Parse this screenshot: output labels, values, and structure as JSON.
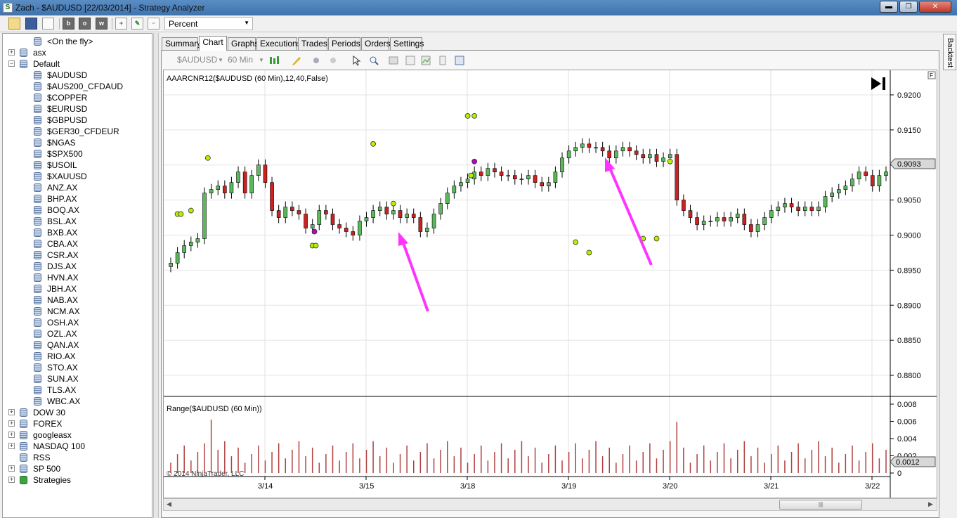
{
  "window": {
    "title": "Zach - $AUDUSD [22/03/2014] - Strategy Analyzer",
    "app_icon": "ninjatrader-icon",
    "controls": [
      "minimize-icon",
      "maximize-icon",
      "close-icon"
    ],
    "control_glyphs": [
      "▬",
      "❐",
      "✕"
    ]
  },
  "toolbar": {
    "buttons": [
      "open-folder-icon",
      "save-icon",
      "print-icon",
      "b-icon",
      "o-icon",
      "w-icon",
      "add-icon",
      "edit-icon",
      "remove-icon"
    ],
    "button_glyphs": [
      "",
      "",
      "",
      "b",
      "o",
      "w",
      "+",
      "✎",
      "−"
    ],
    "mode_select": "Percent"
  },
  "tree": {
    "items": [
      {
        "label": "<On the fly>",
        "level": 1,
        "expander": "",
        "icon": "database-icon"
      },
      {
        "label": "asx",
        "level": 0,
        "expander": "+",
        "icon": "database-icon"
      },
      {
        "label": "Default",
        "level": 0,
        "expander": "−",
        "icon": "database-icon"
      },
      {
        "label": "$AUDUSD",
        "level": 1,
        "expander": "",
        "icon": "database-icon"
      },
      {
        "label": "$AUS200_CFDAUD",
        "level": 1,
        "expander": "",
        "icon": "database-icon"
      },
      {
        "label": "$COPPER",
        "level": 1,
        "expander": "",
        "icon": "database-icon"
      },
      {
        "label": "$EURUSD",
        "level": 1,
        "expander": "",
        "icon": "database-icon"
      },
      {
        "label": "$GBPUSD",
        "level": 1,
        "expander": "",
        "icon": "database-icon"
      },
      {
        "label": "$GER30_CFDEUR",
        "level": 1,
        "expander": "",
        "icon": "database-icon"
      },
      {
        "label": "$NGAS",
        "level": 1,
        "expander": "",
        "icon": "database-icon"
      },
      {
        "label": "$SPX500",
        "level": 1,
        "expander": "",
        "icon": "database-icon"
      },
      {
        "label": "$USOIL",
        "level": 1,
        "expander": "",
        "icon": "database-icon"
      },
      {
        "label": "$XAUUSD",
        "level": 1,
        "expander": "",
        "icon": "database-icon"
      },
      {
        "label": "ANZ.AX",
        "level": 1,
        "expander": "",
        "icon": "database-icon"
      },
      {
        "label": "BHP.AX",
        "level": 1,
        "expander": "",
        "icon": "database-icon"
      },
      {
        "label": "BOQ.AX",
        "level": 1,
        "expander": "",
        "icon": "database-icon"
      },
      {
        "label": "BSL.AX",
        "level": 1,
        "expander": "",
        "icon": "database-icon"
      },
      {
        "label": "BXB.AX",
        "level": 1,
        "expander": "",
        "icon": "database-icon"
      },
      {
        "label": "CBA.AX",
        "level": 1,
        "expander": "",
        "icon": "database-icon"
      },
      {
        "label": "CSR.AX",
        "level": 1,
        "expander": "",
        "icon": "database-icon"
      },
      {
        "label": "DJS.AX",
        "level": 1,
        "expander": "",
        "icon": "database-icon"
      },
      {
        "label": "HVN.AX",
        "level": 1,
        "expander": "",
        "icon": "database-icon"
      },
      {
        "label": "JBH.AX",
        "level": 1,
        "expander": "",
        "icon": "database-icon"
      },
      {
        "label": "NAB.AX",
        "level": 1,
        "expander": "",
        "icon": "database-icon"
      },
      {
        "label": "NCM.AX",
        "level": 1,
        "expander": "",
        "icon": "database-icon"
      },
      {
        "label": "OSH.AX",
        "level": 1,
        "expander": "",
        "icon": "database-icon"
      },
      {
        "label": "OZL.AX",
        "level": 1,
        "expander": "",
        "icon": "database-icon"
      },
      {
        "label": "QAN.AX",
        "level": 1,
        "expander": "",
        "icon": "database-icon"
      },
      {
        "label": "RIO.AX",
        "level": 1,
        "expander": "",
        "icon": "database-icon"
      },
      {
        "label": "STO.AX",
        "level": 1,
        "expander": "",
        "icon": "database-icon"
      },
      {
        "label": "SUN.AX",
        "level": 1,
        "expander": "",
        "icon": "database-icon"
      },
      {
        "label": "TLS.AX",
        "level": 1,
        "expander": "",
        "icon": "database-icon"
      },
      {
        "label": "WBC.AX",
        "level": 1,
        "expander": "",
        "icon": "database-icon"
      },
      {
        "label": "DOW 30",
        "level": 0,
        "expander": "+",
        "icon": "database-icon"
      },
      {
        "label": "FOREX",
        "level": 0,
        "expander": "+",
        "icon": "database-icon"
      },
      {
        "label": "googleasx",
        "level": 0,
        "expander": "+",
        "icon": "database-icon"
      },
      {
        "label": "NASDAQ 100",
        "level": 0,
        "expander": "+",
        "icon": "database-icon"
      },
      {
        "label": "RSS",
        "level": 0,
        "expander": "",
        "icon": "database-icon"
      },
      {
        "label": "SP 500",
        "level": 0,
        "expander": "+",
        "icon": "database-icon"
      },
      {
        "label": "Strategies",
        "level": 0,
        "expander": "+",
        "icon": "strategy-icon"
      }
    ]
  },
  "tabs": [
    "Summary",
    "Chart",
    "Graphs",
    "Executions",
    "Trades",
    "Periods",
    "Orders",
    "Settings"
  ],
  "active_tab": "Chart",
  "side_tab": "Backtest",
  "chart_toolbar": {
    "instrument": "$AUDUSD",
    "interval": "60 Min",
    "icons": [
      "bar-type-icon",
      "drawing-tool-icon",
      "indicator-icon",
      "strategy-icon",
      "cursor-icon",
      "zoom-icon",
      "properties-icon",
      "data-box-icon",
      "chart-style-icon",
      "template-icon",
      "panel-icon"
    ]
  },
  "chart": {
    "indicator_label": "AAARCNR12($AUDUSD (60 Min),12,40,False)",
    "range_label": "Range($AUDUSD (60 Min))",
    "copyright": "© 2014 NinjaTrader, LLC",
    "go_to_end_icon": "skip-to-end-icon",
    "float_button": "F",
    "price_ticks": [
      "0.9200",
      "0.9150",
      "0.9100",
      "0.9050",
      "0.9000",
      "0.8950",
      "0.8900",
      "0.8850",
      "0.8800"
    ],
    "last_price": "0.9093",
    "range_ticks": [
      "0.008",
      "0.006",
      "0.004",
      "0.002",
      "0"
    ],
    "last_range": "0.0012",
    "date_labels": [
      "3/14",
      "3/15",
      "3/18",
      "3/19",
      "3/20",
      "3/21",
      "3/22"
    ],
    "colors": {
      "up": "#5cb85c",
      "down": "#cc2222",
      "dot": "#b7f000",
      "signal": "#c000c0",
      "arrow": "#ff33ff",
      "range_bar": "#b04040"
    }
  },
  "chart_data": {
    "type": "candlestick",
    "title": "AAARCNR12($AUDUSD (60 Min),12,40,False)",
    "ylim": [
      0.878,
      0.9215
    ],
    "x_labels": [
      "3/14",
      "3/15",
      "3/18",
      "3/19",
      "3/20",
      "3/21",
      "3/22"
    ],
    "closes": [
      0.896,
      0.8975,
      0.8985,
      0.899,
      0.8995,
      0.906,
      0.9065,
      0.907,
      0.906,
      0.9075,
      0.909,
      0.906,
      0.9085,
      0.91,
      0.9075,
      0.9035,
      0.9025,
      0.904,
      0.9035,
      0.903,
      0.901,
      0.9015,
      0.9035,
      0.903,
      0.9015,
      0.901,
      0.9005,
      0.9,
      0.902,
      0.9025,
      0.9035,
      0.904,
      0.903,
      0.9035,
      0.9025,
      0.903,
      0.9025,
      0.9005,
      0.901,
      0.903,
      0.9045,
      0.906,
      0.907,
      0.9075,
      0.908,
      0.909,
      0.9085,
      0.9095,
      0.909,
      0.9085,
      0.9085,
      0.908,
      0.908,
      0.9085,
      0.9075,
      0.907,
      0.9075,
      0.909,
      0.911,
      0.912,
      0.9125,
      0.913,
      0.9125,
      0.9125,
      0.912,
      0.911,
      0.912,
      0.9125,
      0.912,
      0.9115,
      0.911,
      0.9115,
      0.9105,
      0.911,
      0.9115,
      0.905,
      0.9035,
      0.9025,
      0.9015,
      0.902,
      0.902,
      0.9025,
      0.902,
      0.9025,
      0.903,
      0.9015,
      0.9005,
      0.9015,
      0.9025,
      0.9035,
      0.904,
      0.9045,
      0.904,
      0.9035,
      0.904,
      0.9035,
      0.904,
      0.9055,
      0.906,
      0.9065,
      0.907,
      0.908,
      0.909,
      0.9085,
      0.907,
      0.9085,
      0.909
    ],
    "dots": [
      [
        1,
        0.903
      ],
      [
        1.5,
        0.903
      ],
      [
        3,
        0.9035
      ],
      [
        5.5,
        0.911
      ],
      [
        21,
        0.8985
      ],
      [
        21.5,
        0.8985
      ],
      [
        30,
        0.913
      ],
      [
        33,
        0.9045
      ],
      [
        44,
        0.917
      ],
      [
        45,
        0.917
      ],
      [
        44.5,
        0.9085
      ],
      [
        60,
        0.899
      ],
      [
        62,
        0.8975
      ],
      [
        70,
        0.8995
      ],
      [
        72,
        0.8995
      ],
      [
        74,
        0.9105
      ]
    ],
    "signals": [
      [
        21.3,
        0.9005
      ],
      [
        45,
        0.9105
      ]
    ],
    "range_series_peak": 0.0068
  }
}
